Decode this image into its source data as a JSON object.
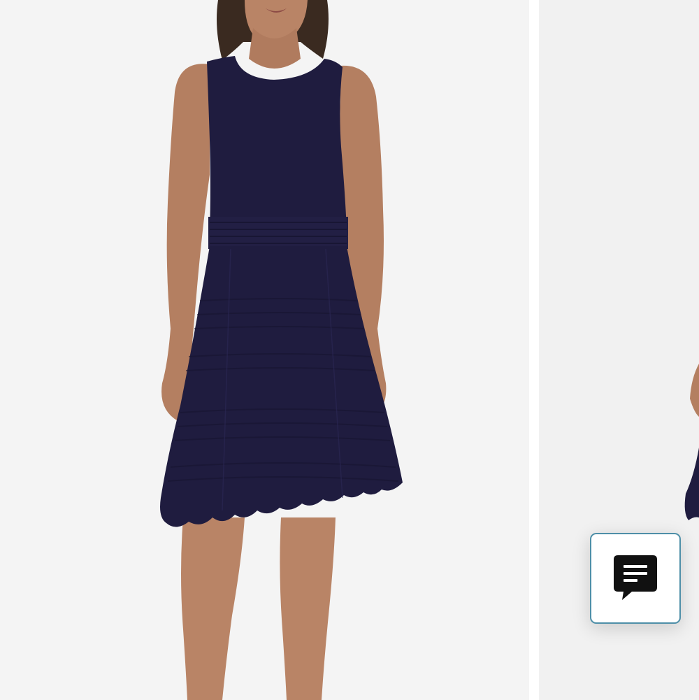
{
  "gallery": {
    "images": [
      {
        "icon": "product-photo-navy-sleeveless-knit-dress",
        "fabric_color": "#1f1c3f"
      },
      {
        "icon": "product-photo-next-partial",
        "fabric_color": "#1f1c3f"
      }
    ],
    "background_color": "#f4f4f4",
    "divider_color": "#ffffff"
  },
  "chat": {
    "icon": "chat-bubble-icon",
    "border_color": "#4e8fa8",
    "icon_color": "#111111"
  }
}
